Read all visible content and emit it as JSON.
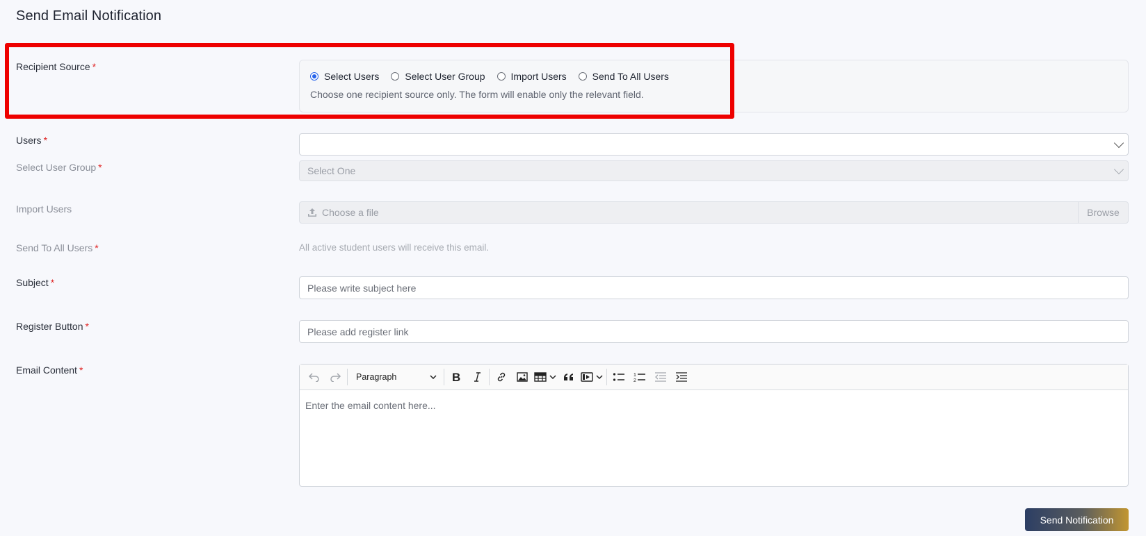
{
  "page": {
    "title": "Send Email Notification"
  },
  "recipient": {
    "label": "Recipient Source",
    "required_mark": "*",
    "options": [
      {
        "label": "Select Users",
        "checked": true
      },
      {
        "label": "Select User Group",
        "checked": false
      },
      {
        "label": "Import Users",
        "checked": false
      },
      {
        "label": "Send To All Users",
        "checked": false
      }
    ],
    "hint": "Choose one recipient source only. The form will enable only the relevant field."
  },
  "users": {
    "label": "Users",
    "required_mark": "*",
    "value": ""
  },
  "user_group": {
    "label": "Select User Group",
    "required_mark": "*",
    "value": "Select One"
  },
  "import_users": {
    "label": "Import Users",
    "file_placeholder": "Choose a file",
    "browse_label": "Browse"
  },
  "send_all": {
    "label": "Send To All Users",
    "required_mark": "*",
    "note": "All active student users will receive this email."
  },
  "subject": {
    "label": "Subject",
    "required_mark": "*",
    "placeholder": "Please write subject here"
  },
  "register_button": {
    "label": "Register Button",
    "required_mark": "*",
    "placeholder": "Please add register link"
  },
  "email_content": {
    "label": "Email Content",
    "required_mark": "*",
    "paragraph_style": "Paragraph",
    "placeholder": "Enter the email content here..."
  },
  "actions": {
    "send_label": "Send Notification"
  },
  "colors": {
    "required": "#e02424",
    "radio_checked": "#2563eb",
    "highlight": "#ee0000"
  }
}
